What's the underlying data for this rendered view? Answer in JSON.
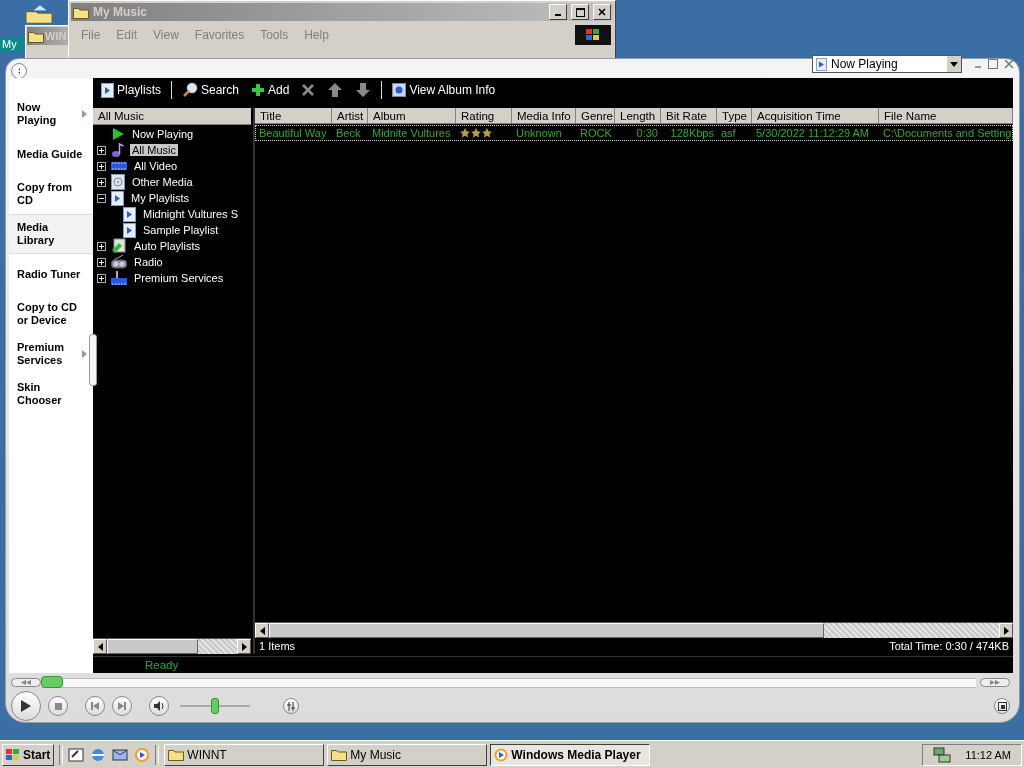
{
  "desktop": {
    "icon_label": "My"
  },
  "background_windows": [
    {
      "title": "WIN"
    },
    {
      "title": "My Music",
      "menu": [
        "File",
        "Edit",
        "View",
        "Favorites",
        "Tools",
        "Help"
      ]
    }
  ],
  "player": {
    "view_selector": {
      "value": "Now Playing"
    },
    "sidebar": [
      {
        "label": "Now Playing",
        "kind": "menu",
        "selected": false
      },
      {
        "label": "Media Guide",
        "kind": "plain",
        "selected": false
      },
      {
        "label": "Copy from CD",
        "kind": "plain",
        "selected": false
      },
      {
        "label": "Media Library",
        "kind": "plain",
        "selected": true
      },
      {
        "label": "Radio Tuner",
        "kind": "plain",
        "selected": false
      },
      {
        "label": "Copy to CD or Device",
        "kind": "plain",
        "selected": false
      },
      {
        "label": "Premium Services",
        "kind": "menu",
        "selected": false
      },
      {
        "label": "Skin Chooser",
        "kind": "plain",
        "selected": false
      }
    ],
    "toolbar": [
      {
        "kind": "playlists",
        "label": "Playlists"
      },
      {
        "kind": "search",
        "label": "Search"
      },
      {
        "kind": "add",
        "label": "Add"
      },
      {
        "kind": "delete"
      },
      {
        "kind": "up"
      },
      {
        "kind": "down"
      },
      {
        "kind": "album-info",
        "label": "View Album Info"
      }
    ],
    "tree_header": "All Music",
    "tree": [
      {
        "label": "Now Playing",
        "kind": "now-playing",
        "selected": false
      },
      {
        "label": "All Music",
        "kind": "music",
        "selected": true,
        "expanded": false
      },
      {
        "label": "All Video",
        "kind": "video",
        "selected": false,
        "expanded": false
      },
      {
        "label": "Other Media",
        "kind": "media",
        "selected": false,
        "expanded": false
      },
      {
        "label": "My Playlists",
        "kind": "playlists",
        "selected": false,
        "expanded": true,
        "children": [
          {
            "label": "Midnight Vultures S",
            "kind": "playlist",
            "selected": false
          },
          {
            "label": "Sample Playlist",
            "kind": "playlist",
            "selected": false
          }
        ]
      },
      {
        "label": "Auto Playlists",
        "kind": "auto-playlists",
        "selected": false,
        "expanded": false
      },
      {
        "label": "Radio",
        "kind": "radio",
        "selected": false,
        "expanded": false
      },
      {
        "label": "Premium Services",
        "kind": "services",
        "selected": false,
        "expanded": false
      }
    ],
    "columns": [
      {
        "label": "Title",
        "kind": "text"
      },
      {
        "label": "Artist",
        "kind": "text"
      },
      {
        "label": "Album",
        "kind": "text"
      },
      {
        "label": "Rating",
        "kind": "rating"
      },
      {
        "label": "Media Info",
        "kind": "text"
      },
      {
        "label": "Genre",
        "kind": "text"
      },
      {
        "label": "Length",
        "kind": "number"
      },
      {
        "label": "Bit Rate",
        "kind": "number"
      },
      {
        "label": "Type",
        "kind": "text"
      },
      {
        "label": "Acquisition Time",
        "kind": "text"
      },
      {
        "label": "File Name",
        "kind": "text"
      }
    ],
    "rows": [
      {
        "cells": [
          "Beautiful Way",
          "Beck",
          "Midnite Vultures",
          "",
          "Unknown",
          "ROCK",
          "0:30",
          "128Kbps",
          "asf",
          "5/30/2022 11:12:29 AM",
          "C:\\Documents and Setting"
        ],
        "stars": 3,
        "selected": true
      }
    ],
    "item_count": "1 Items",
    "total": "Total Time: 0:30 / 474KB",
    "status": "Ready",
    "seek": {
      "level": 0
    },
    "volume": {
      "level": 0.5
    }
  },
  "taskbar": {
    "start": "Start",
    "tasks": [
      {
        "label": "WINNT",
        "kind": "folder",
        "selected": false
      },
      {
        "label": "My Music",
        "kind": "folder",
        "selected": false
      },
      {
        "label": "Windows Media Player",
        "kind": "player",
        "selected": true
      }
    ],
    "clock": "11:12 AM"
  }
}
